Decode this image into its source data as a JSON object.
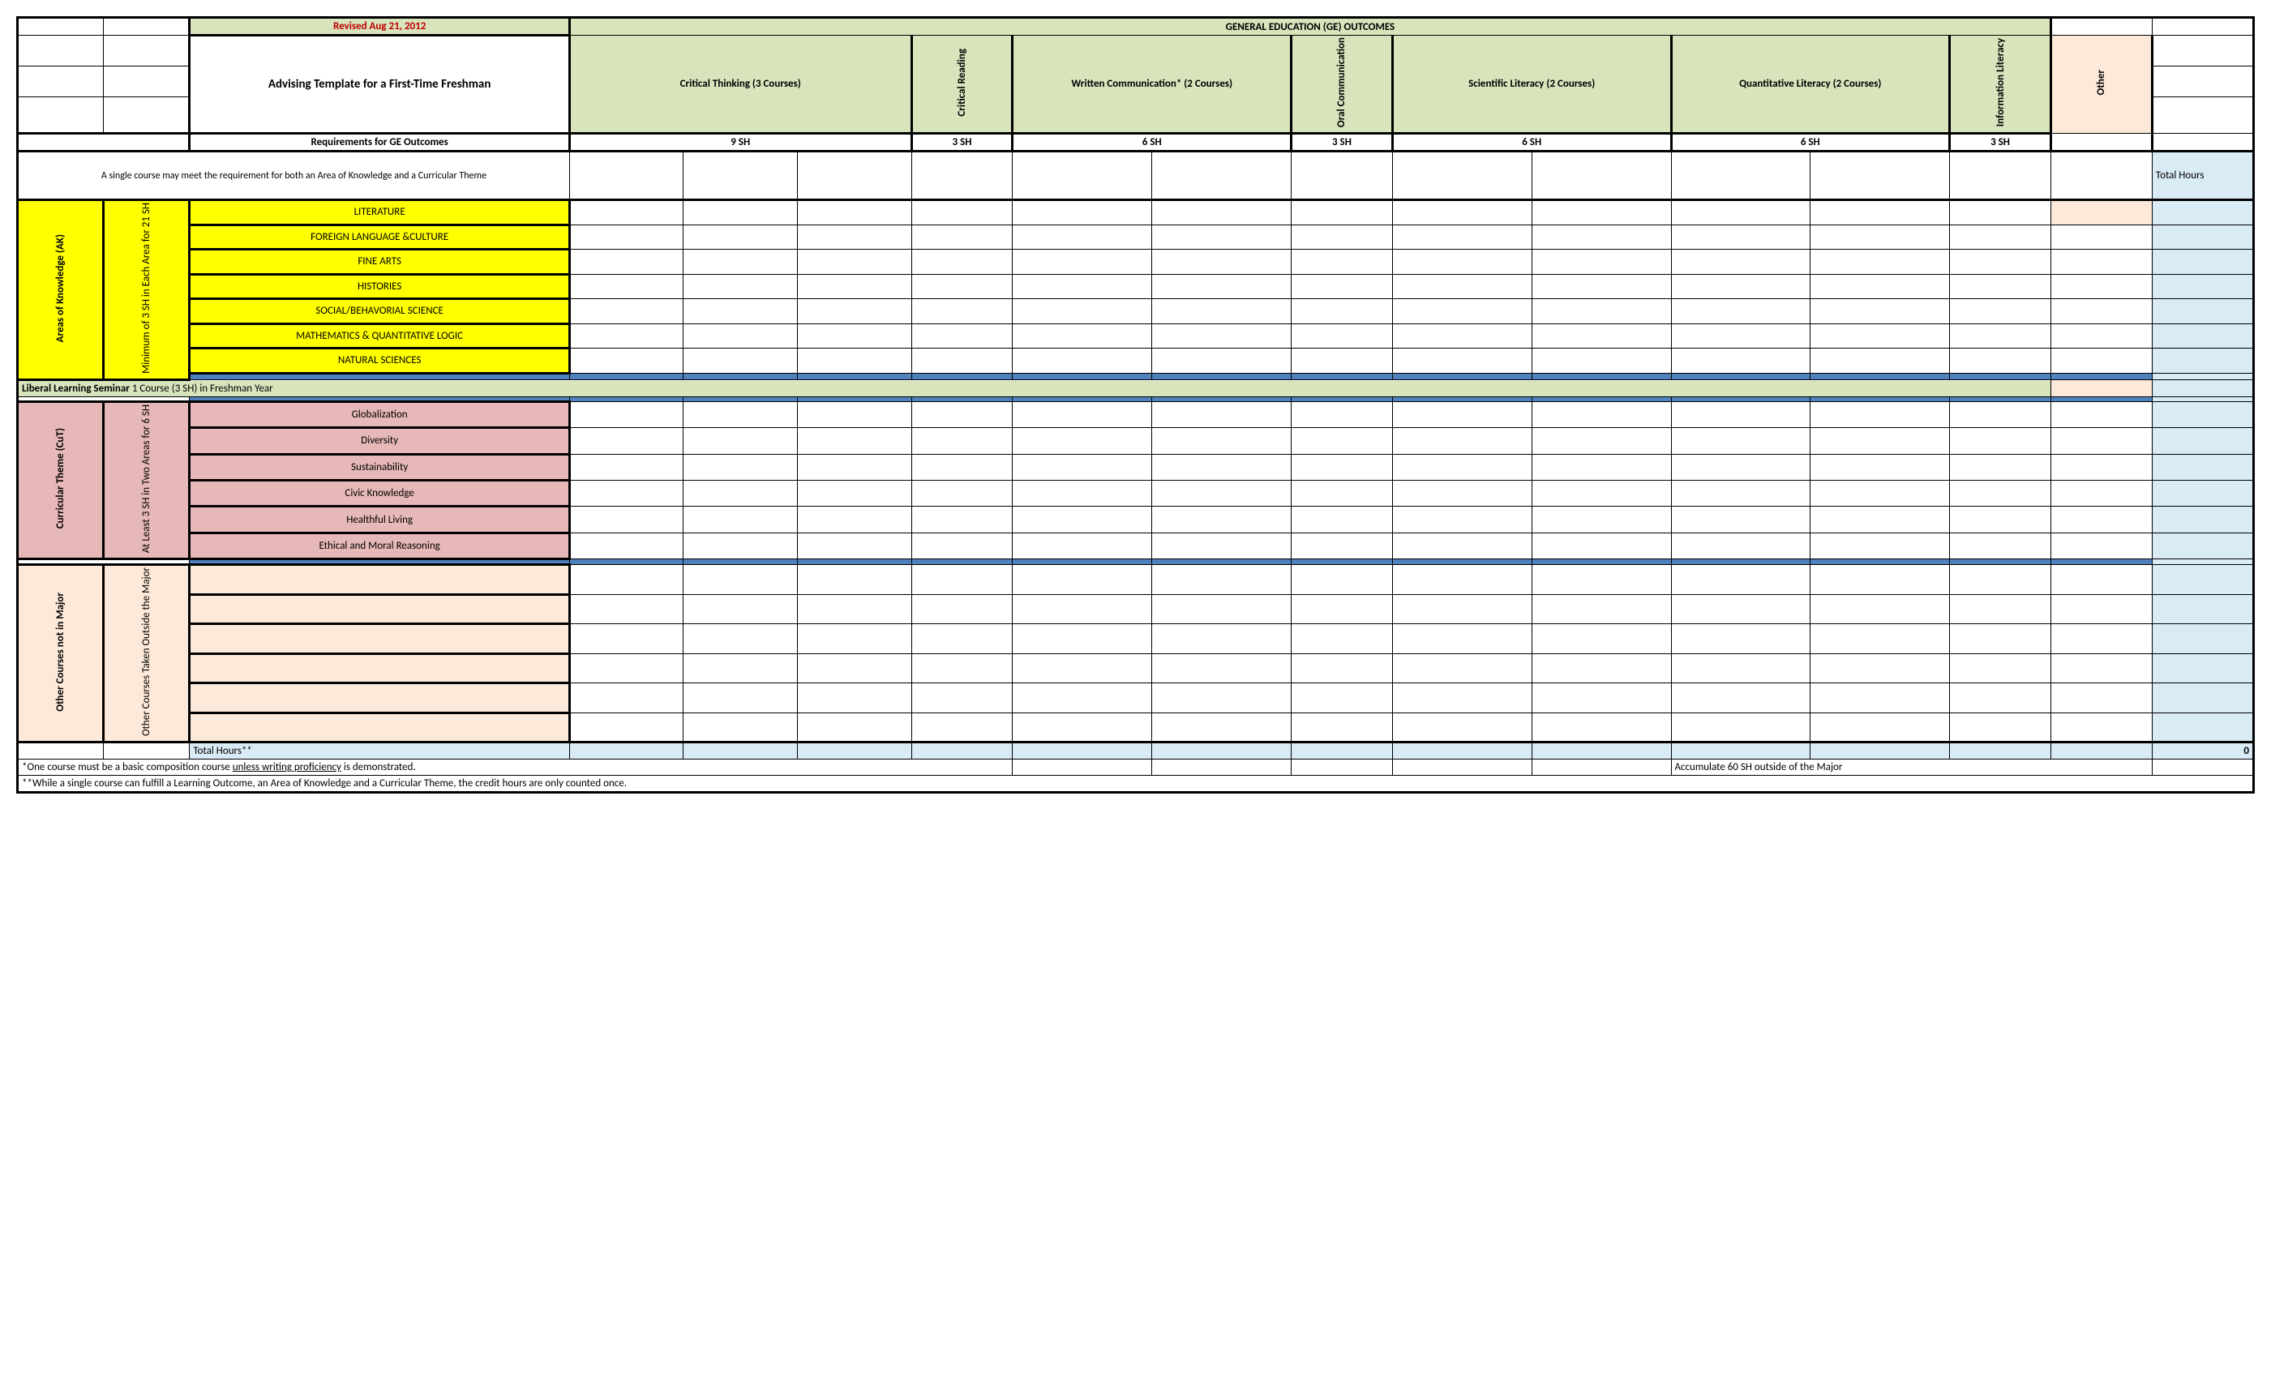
{
  "header": {
    "revised": "Revised Aug 21, 2012",
    "title": "Advising Template for a First-Time Freshman",
    "ge_outcomes": "GENERAL EDUCATION (GE) OUTCOMES",
    "requirements_label": "Requirements for GE Outcomes"
  },
  "outcomes": {
    "critical_thinking": "Critical Thinking (3 Courses)",
    "critical_reading": "Critical Reading",
    "written_comm": "Written Communication*  (2 Courses)",
    "oral_comm": "Oral Communication",
    "scientific": "Scientific Literacy               (2 Courses)",
    "quantitative": "Quantitative Literacy          (2 Courses)",
    "info_literacy": "Information Literacy",
    "other": "Other"
  },
  "sh": {
    "ct": "9 SH",
    "cr": "3 SH",
    "wc": "6 SH",
    "oc": "3 SH",
    "sl": "6 SH",
    "ql": "6 SH",
    "il": "3 SH"
  },
  "note_top": "A single course may meet the requirement for both an Area of Knowledge and a Curricular Theme",
  "total_hours_label": "Total Hours",
  "ak": {
    "label": "Areas of Knowledge (AK)",
    "sub": "Minimum of 3 SH in Each Area for 21 SH",
    "rows": [
      "LITERATURE",
      "FOREIGN LANGUAGE &CULTURE",
      "FINE ARTS",
      "HISTORIES",
      "SOCIAL/BEHAVORIAL SCIENCE",
      "MATHEMATICS & QUANTITATIVE LOGIC",
      "NATURAL SCIENCES"
    ]
  },
  "lls": {
    "b": "Liberal Learning Seminar",
    "r": "  1 Course (3 SH) in Freshman Year"
  },
  "cut": {
    "label": "Curricular Theme (CuT)",
    "sub": "At Least 3 SH in Two Areas for 6 SH",
    "rows": [
      "Globalization",
      "Diversity",
      "Sustainability",
      "Civic Knowledge",
      "Healthful Living",
      "Ethical and Moral Reasoning"
    ]
  },
  "other_section": {
    "label": "Other Courses not in Major",
    "sub": "Other Courses Taken Outside the Major"
  },
  "total_hours_row": "Total Hours**",
  "total_value": "0",
  "footnote1_a": "*One course must be a basic composition course ",
  "footnote1_b": "unless writing proficiency",
  "footnote1_c": " is demonstrated.",
  "footnote2": "**While a single course can fulfill a Learning Outcome, an Area of Knowledge and a Curricular Theme, the credit hours are only counted once.",
  "accumulate": "Accumulate 60 SH outside of the Major"
}
